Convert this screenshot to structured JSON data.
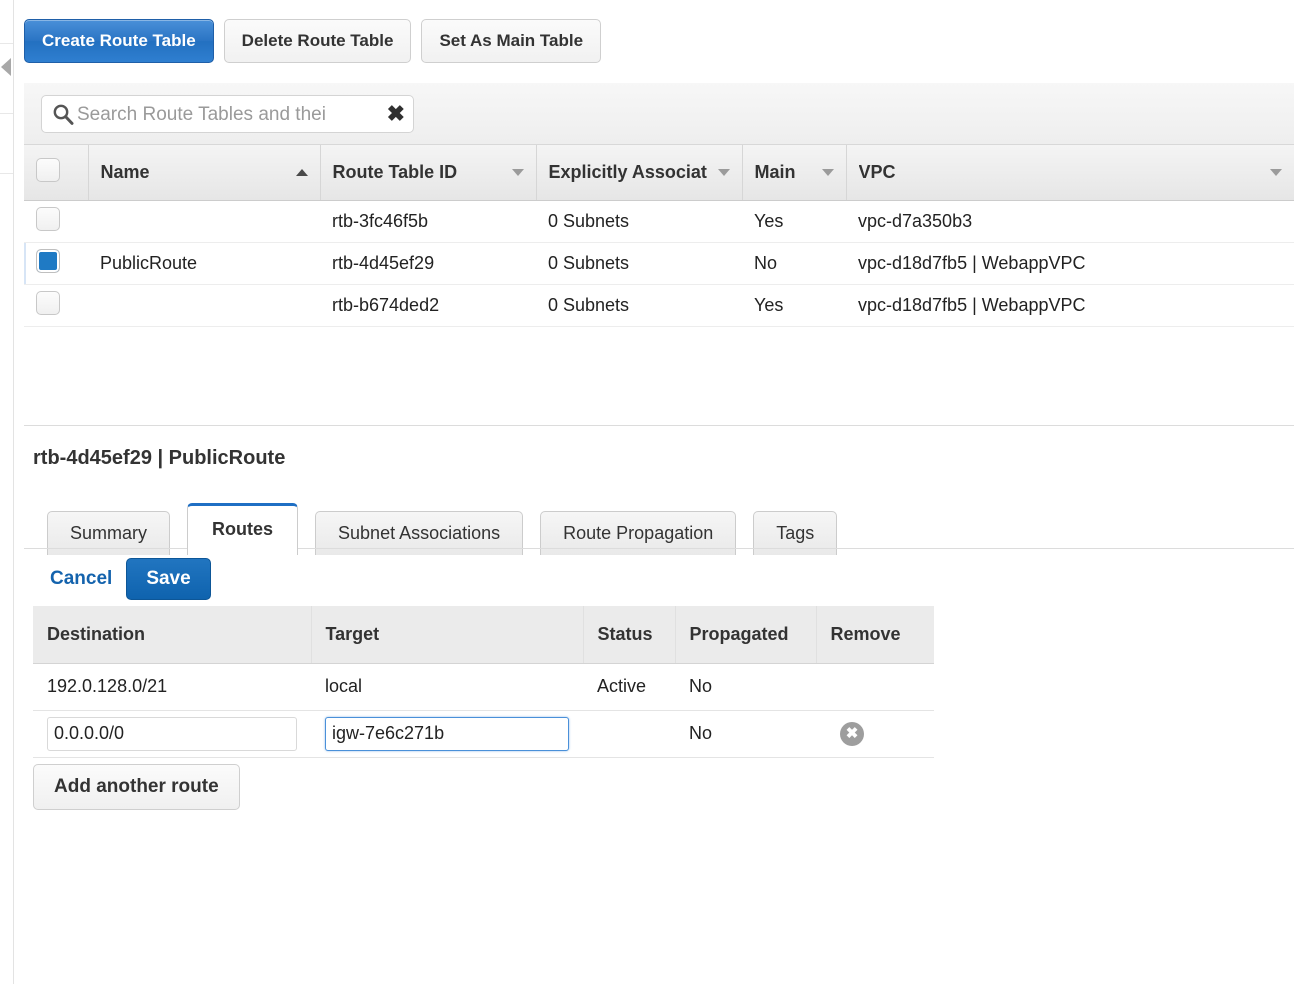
{
  "toolbar": {
    "create_label": "Create Route Table",
    "delete_label": "Delete Route Table",
    "set_main_label": "Set As Main Table"
  },
  "search": {
    "placeholder": "Search Route Tables and thei",
    "value": "",
    "clear_glyph": "✖"
  },
  "list_table": {
    "columns": [
      {
        "label": "Name",
        "sort": "asc"
      },
      {
        "label": "Route Table ID",
        "sort": "desc"
      },
      {
        "label": "Explicitly Associat",
        "sort": "desc"
      },
      {
        "label": "Main",
        "sort": "desc"
      },
      {
        "label": "VPC",
        "sort": "desc"
      }
    ],
    "rows": [
      {
        "selected": false,
        "name": "",
        "route_table_id": "rtb-3fc46f5b",
        "explicit_associations": "0 Subnets",
        "main": "Yes",
        "vpc": "vpc-d7a350b3"
      },
      {
        "selected": true,
        "name": "PublicRoute",
        "route_table_id": "rtb-4d45ef29",
        "explicit_associations": "0 Subnets",
        "main": "No",
        "vpc": "vpc-d18d7fb5 | WebappVPC"
      },
      {
        "selected": false,
        "name": "",
        "route_table_id": "rtb-b674ded2",
        "explicit_associations": "0 Subnets",
        "main": "Yes",
        "vpc": "vpc-d18d7fb5 | WebappVPC"
      }
    ]
  },
  "detail": {
    "title": "rtb-4d45ef29 | PublicRoute",
    "tabs": [
      {
        "label": "Summary",
        "active": false
      },
      {
        "label": "Routes",
        "active": true
      },
      {
        "label": "Subnet Associations",
        "active": false
      },
      {
        "label": "Route Propagation",
        "active": false
      },
      {
        "label": "Tags",
        "active": false
      }
    ],
    "actions": {
      "cancel_label": "Cancel",
      "save_label": "Save",
      "add_route_label": "Add another route"
    },
    "routes_table": {
      "columns": [
        "Destination",
        "Target",
        "Status",
        "Propagated",
        "Remove"
      ],
      "rows": [
        {
          "editable": false,
          "destination": "192.0.128.0/21",
          "target": "local",
          "status": "Active",
          "propagated": "No",
          "removable": false
        },
        {
          "editable": true,
          "destination": "0.0.0.0/0",
          "target": "igw-7e6c271b",
          "target_focused": true,
          "status": "",
          "propagated": "No",
          "removable": true,
          "remove_glyph": "✖"
        }
      ]
    }
  },
  "colors": {
    "primary_blue": "#2a74c4",
    "save_blue": "#0f63ae",
    "link_blue": "#1463ad",
    "selected_row": "#eaf2fb",
    "active_green": "#1a9b34",
    "tab_accent": "#1f6fc4"
  }
}
